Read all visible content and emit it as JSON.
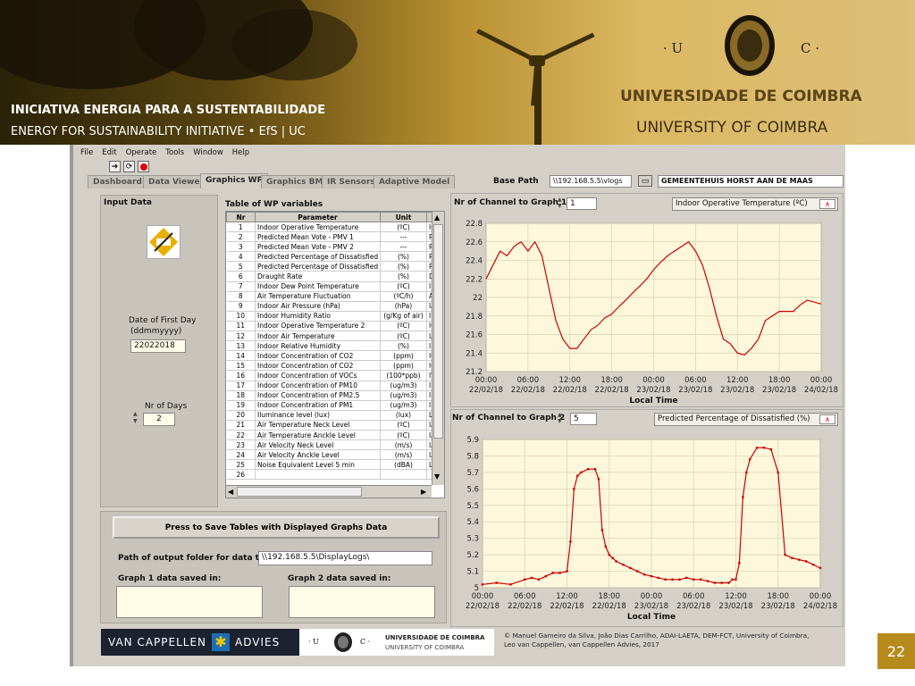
{
  "banner": {
    "pt_line": "INICIATIVA ENERGIA  PARA  A  SUSTENTABILIDADE",
    "en_line": "ENERGY  FOR  SUSTAINABILITY  INITIATIVE •    EfS | UC",
    "uni_pt": "UNIVERSIDADE  DE  COIMBRA",
    "uni_en": "UNIVERSITY  OF  COIMBRA",
    "logo_left": "·  U",
    "logo_right": "C  ·"
  },
  "slide_number": "22",
  "menu": [
    "File",
    "Edit",
    "Operate",
    "Tools",
    "Window",
    "Help"
  ],
  "tabs": [
    "Dashboard",
    "Data Viewer",
    "Graphics WP",
    "Graphics BM",
    "IR Sensors",
    "Adaptive Model"
  ],
  "active_tab": "Graphics WP",
  "base_path_label": "Base Path",
  "base_path_value": "\\\\192.168.5.5\\vlogs",
  "site_name": "GEMEENTEHUIS HORST AAN DE MAAS",
  "input": {
    "title": "Input Data",
    "date_label": "Date of First Day",
    "date_format": "(ddmmyyyy)",
    "date_value": "22022018",
    "days_label": "Nr of Days",
    "days_value": "2"
  },
  "table": {
    "title": "Table of WP variables",
    "headers": [
      "Nr",
      "Parameter",
      "Unit",
      ""
    ],
    "rows": [
      [
        "1",
        "Indoor Operative Temperature",
        "(ºC)",
        "IOT"
      ],
      [
        "2",
        "Predicted Mean Vote - PMV 1",
        "---",
        "PM"
      ],
      [
        "3",
        "Predicted Mean Vote - PMV 2",
        "---",
        "PM"
      ],
      [
        "4",
        "Predicted Percentage of Dissatisfied",
        "(%)",
        "PP"
      ],
      [
        "5",
        "Predicted Percentage of Dissatisfied",
        "(%)",
        "PP"
      ],
      [
        "6",
        "Draught Rate",
        "(%)",
        "DR"
      ],
      [
        "7",
        "Indoor Dew Point Temperature",
        "(ºC)",
        "IDI"
      ],
      [
        "8",
        "Air Temperature Fluctuation",
        "(ºC/h)",
        "AT"
      ],
      [
        "9",
        "Indoor Air Pressure (hPa)",
        "(hPa)",
        "IAF"
      ],
      [
        "10",
        "Indoor Humidity Ratio",
        "(g/Kg of air)",
        "IHI"
      ],
      [
        "11",
        "Indoor Operative Temperature 2",
        "(ºC)",
        "IOT"
      ],
      [
        "12",
        "Indoor Air Temperature",
        "(ºC)",
        "IAT"
      ],
      [
        "13",
        "Indoor Relative Humidity",
        "(%)",
        "IRH"
      ],
      [
        "14",
        "Indoor Concentration of CO2",
        "(ppm)",
        "ICC"
      ],
      [
        "15",
        "Indoor Concentration of CO2",
        "(ppm)",
        "ICC"
      ],
      [
        "16",
        "Indoor Concentration of VOCs",
        "(100*ppb)",
        "IVC"
      ],
      [
        "17",
        "Indoor Concentration of PM10",
        "(ug/m3)",
        "IPN"
      ],
      [
        "18",
        "Indoor Concentration of PM2.5",
        "(ug/m3)",
        "IPN"
      ],
      [
        "19",
        "Indoor Concentration of PM1",
        "(ug/m3)",
        "IPN"
      ],
      [
        "20",
        "Iluminance level (lux)",
        "(lux)",
        "Lx"
      ],
      [
        "21",
        "Air Temperature Neck Level",
        "(ºC)",
        "IAT"
      ],
      [
        "22",
        "Air Temperature Anckle Level",
        "(ºC)",
        "IAT"
      ],
      [
        "23",
        "Air Velocity Neck Level",
        "(m/s)",
        "IAV"
      ],
      [
        "24",
        "Air Velocity Anckle Level",
        "(m/s)",
        "IAV"
      ],
      [
        "25",
        "Noise Equivalent Level 5 min",
        "(dBA)",
        "Lae"
      ],
      [
        "26",
        "",
        "",
        ""
      ]
    ]
  },
  "save_button": "Press to Save Tables with Displayed Graphs Data",
  "output_folder_label": "Path of output folder for data table",
  "output_folder_value": "\\\\192.168.5.5\\DisplayLogs\\",
  "graph1_saved_label": "Graph 1 data saved in:",
  "graph2_saved_label": "Graph 2 data saved in:",
  "graph1": {
    "channel_label": "Nr of Channel to Graph 1",
    "channel_value": "1",
    "legend": "Indoor Operative Temperature (ºC)",
    "xlabel": "Local Time"
  },
  "graph2": {
    "channel_label": "Nr of Channel to Graph 2",
    "channel_value": "5",
    "legend": "Predicted Percentage of Dissatisfied (%)",
    "xlabel": "Local Time"
  },
  "footer": {
    "brand_left": "VAN CAPPELLEN",
    "brand_right": "ADVIES",
    "uni_pt": "UNIVERSIDADE  DE  COIMBRA",
    "uni_en": "UNIVERSITY  OF  COIMBRA",
    "copyright": "© Manuel Gameiro da Silva, João Dias Carrilho, ADAI-LAETA, DEM-FCT, University  of Coimbra,\n  Leo van Cappellen, van Cappellen Advies, 2017"
  },
  "chart_data": [
    {
      "type": "line",
      "ylim": [
        21.2,
        22.8
      ],
      "yticks": [
        "21.2",
        "21.4",
        "21.6",
        "21.8",
        "22",
        "22.2",
        "22.4",
        "22.6",
        "22.8"
      ],
      "xticks": [
        [
          "00:00",
          "22/02/18"
        ],
        [
          "06:00",
          "22/02/18"
        ],
        [
          "12:00",
          "22/02/18"
        ],
        [
          "18:00",
          "22/02/18"
        ],
        [
          "00:00",
          "23/02/18"
        ],
        [
          "06:00",
          "23/02/18"
        ],
        [
          "12:00",
          "23/02/18"
        ],
        [
          "18:00",
          "23/02/18"
        ],
        [
          "00:00",
          "24/02/18"
        ]
      ],
      "xlabel": "Local Time",
      "color": "#cc0000",
      "x_hours": [
        0,
        1,
        2,
        3,
        4,
        5,
        6,
        7,
        8,
        9,
        10,
        11,
        12,
        13,
        14,
        15,
        16,
        17,
        18,
        19,
        20,
        21,
        22,
        23,
        24,
        25,
        26,
        27,
        28,
        29,
        30,
        31,
        32,
        33,
        34,
        35,
        36,
        37,
        38,
        39,
        40,
        41,
        42,
        43,
        44,
        45,
        46,
        47,
        48
      ],
      "values": [
        22.2,
        22.35,
        22.5,
        22.45,
        22.55,
        22.6,
        22.5,
        22.6,
        22.45,
        22.1,
        21.75,
        21.55,
        21.45,
        21.45,
        21.55,
        21.65,
        21.7,
        21.78,
        21.82,
        21.9,
        21.97,
        22.05,
        22.12,
        22.2,
        22.3,
        22.38,
        22.45,
        22.5,
        22.55,
        22.6,
        22.5,
        22.35,
        22.1,
        21.8,
        21.55,
        21.5,
        21.4,
        21.38,
        21.45,
        21.55,
        21.75,
        21.8,
        21.85,
        21.85,
        21.85,
        21.92,
        21.97,
        21.95,
        21.93
      ]
    },
    {
      "type": "line",
      "ylim": [
        5,
        5.9
      ],
      "yticks": [
        "5",
        "5.1",
        "5.2",
        "5.3",
        "5.4",
        "5.5",
        "5.6",
        "5.7",
        "5.8",
        "5.9"
      ],
      "xticks": [
        [
          "00:00",
          "22/02/18"
        ],
        [
          "06:00",
          "22/02/18"
        ],
        [
          "12:00",
          "22/02/18"
        ],
        [
          "18:00",
          "22/02/18"
        ],
        [
          "00:00",
          "23/02/18"
        ],
        [
          "06:00",
          "23/02/18"
        ],
        [
          "12:00",
          "23/02/18"
        ],
        [
          "18:00",
          "23/02/18"
        ],
        [
          "00:00",
          "24/02/18"
        ]
      ],
      "xlabel": "Local Time",
      "color": "#cc0000",
      "x_hours": [
        0,
        2,
        4,
        6,
        7,
        8,
        9,
        10,
        11,
        12,
        12.5,
        13,
        13.5,
        14,
        15,
        16,
        16.5,
        17,
        17.5,
        18,
        18.5,
        19,
        20,
        21,
        22,
        23,
        24,
        25,
        26,
        27,
        28,
        29,
        30,
        31,
        32,
        33,
        34,
        35,
        35.5,
        36,
        36.5,
        37,
        37.5,
        38,
        39,
        40,
        41,
        42,
        43,
        44,
        45,
        46,
        47,
        48
      ],
      "values": [
        5.02,
        5.03,
        5.02,
        5.05,
        5.06,
        5.05,
        5.07,
        5.09,
        5.09,
        5.1,
        5.28,
        5.6,
        5.68,
        5.7,
        5.72,
        5.72,
        5.66,
        5.35,
        5.25,
        5.2,
        5.18,
        5.16,
        5.14,
        5.12,
        5.1,
        5.08,
        5.07,
        5.06,
        5.05,
        5.05,
        5.05,
        5.06,
        5.05,
        5.05,
        5.04,
        5.03,
        5.03,
        5.03,
        5.05,
        5.05,
        5.15,
        5.55,
        5.7,
        5.78,
        5.85,
        5.85,
        5.84,
        5.7,
        5.2,
        5.18,
        5.17,
        5.16,
        5.14,
        5.12
      ]
    }
  ]
}
